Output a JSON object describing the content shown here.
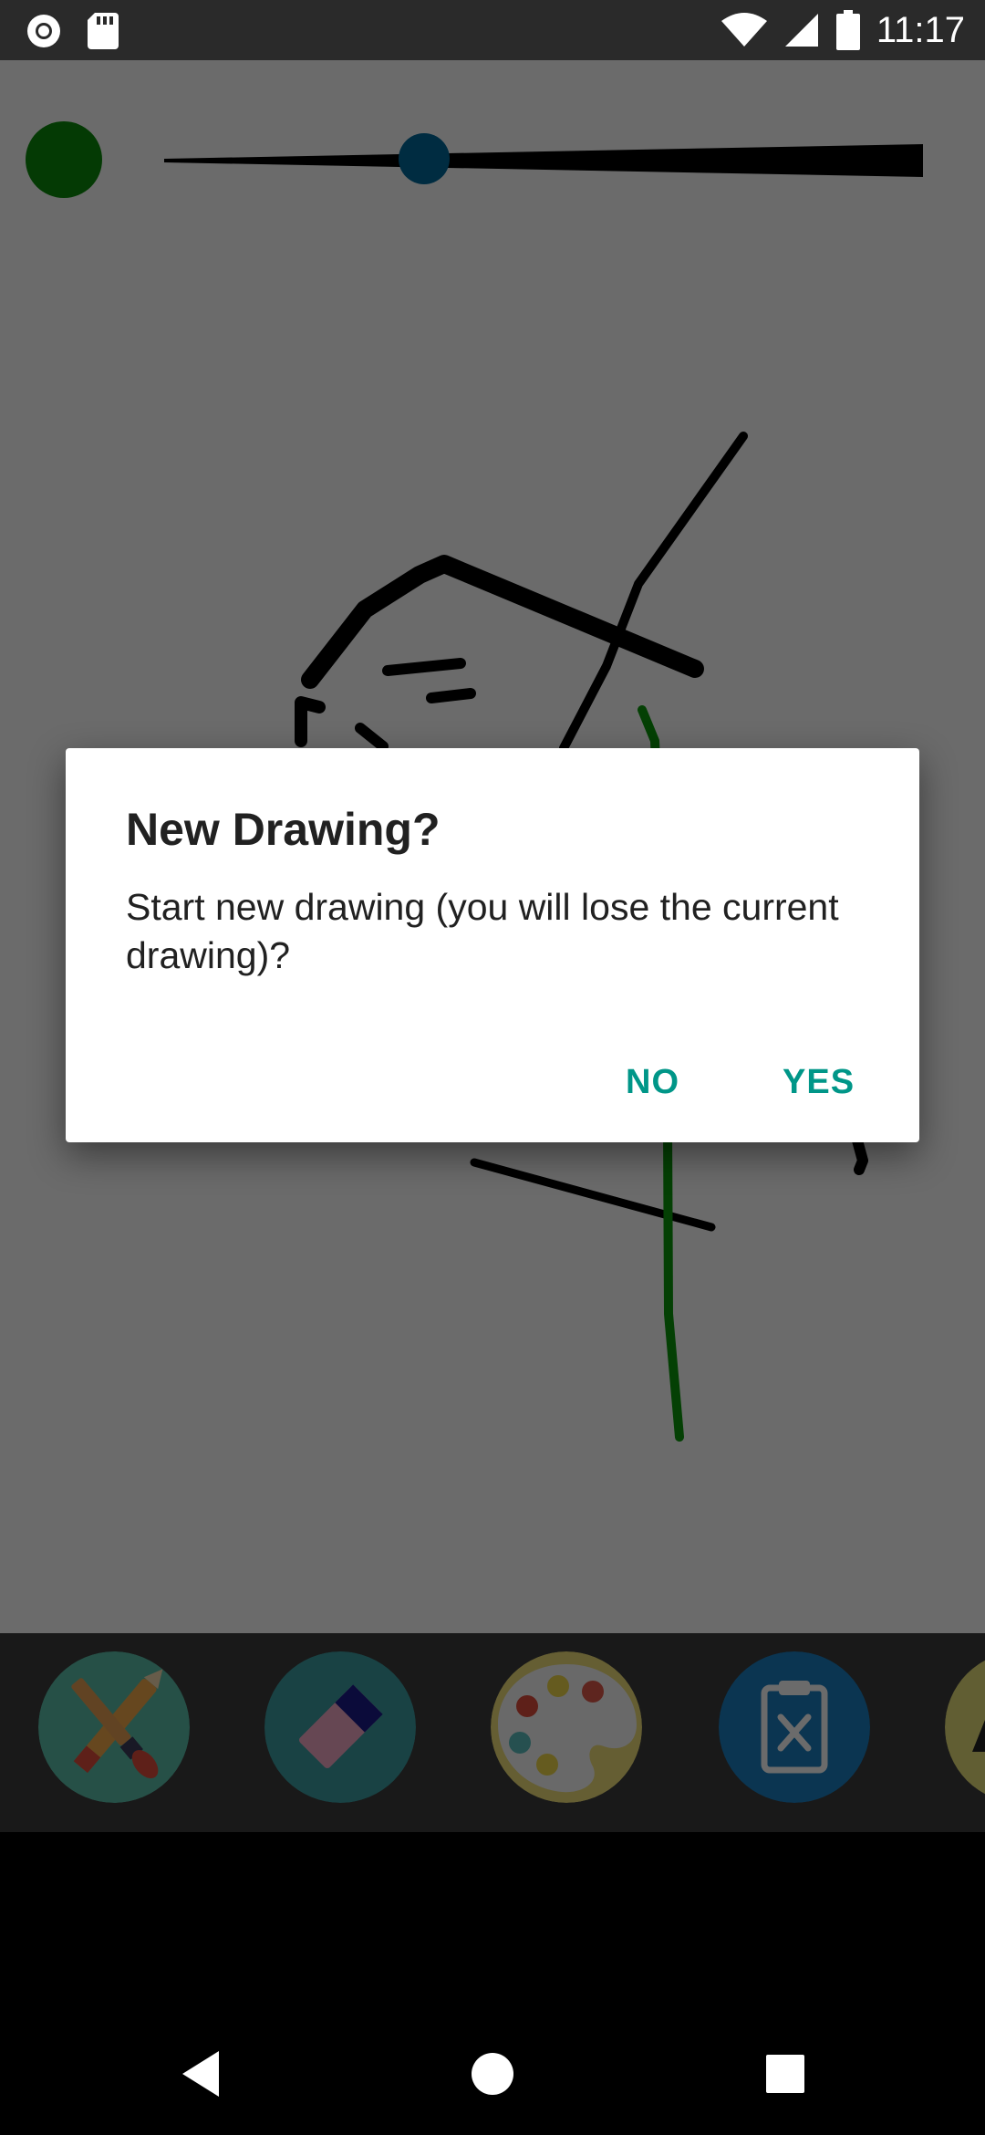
{
  "status_bar": {
    "time": "11:17",
    "icons": [
      "record-icon",
      "sd-card-icon",
      "wifi-icon",
      "cell-signal-icon",
      "battery-icon"
    ]
  },
  "canvas": {
    "selected_color": "#0a8a0a",
    "brush_size_slider": {
      "value": 0.34
    }
  },
  "toolbar": {
    "tools": [
      "brush-tool-icon",
      "eraser-tool-icon",
      "palette-tool-icon",
      "clear-clipboard-icon",
      "more-tool-icon"
    ]
  },
  "dialog": {
    "title": "New Drawing?",
    "message": "Start new drawing (you will lose the current drawing)?",
    "no_label": "NO",
    "yes_label": "YES"
  },
  "colors": {
    "accent": "#009688",
    "stroke_black": "#000000",
    "stroke_green": "#0a9a0a",
    "slider_thumb": "#00699c"
  }
}
